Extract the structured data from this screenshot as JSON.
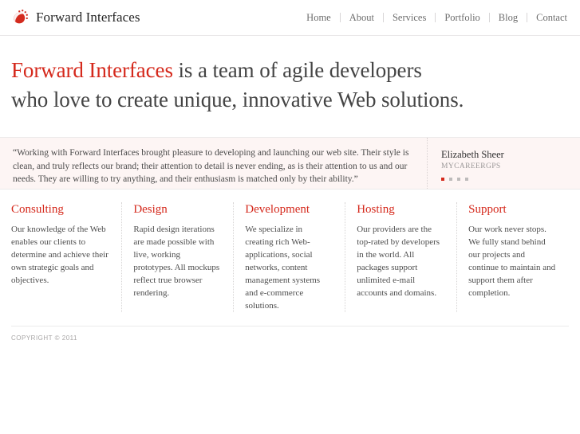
{
  "header": {
    "brand": {
      "logo_icon": "droplet-dots-logo-icon",
      "name": "Forward Interfaces"
    },
    "nav": [
      {
        "label": "Home"
      },
      {
        "label": "About"
      },
      {
        "label": "Services"
      },
      {
        "label": "Portfolio"
      },
      {
        "label": "Blog"
      },
      {
        "label": "Contact"
      }
    ]
  },
  "hero": {
    "accent": "Forward Interfaces",
    "line1_rest": " is a team of agile developers",
    "line2": "who love to create unique, innovative Web solutions."
  },
  "testimonial": {
    "quote": "“Working with Forward Interfaces brought pleasure to developing and launching our web site. Their style is clean, and truly reflects our brand; their attention to detail is never ending, as is their attention to us and our needs. They are willing to try anything, and their enthusiasm is matched only by their ability.”",
    "author_name": "Elizabeth Sheer",
    "author_company": "MYCAREERGPS",
    "dots": [
      {
        "active": true
      },
      {
        "active": false
      },
      {
        "active": false
      },
      {
        "active": false
      }
    ]
  },
  "services": [
    {
      "title": "Consulting",
      "body": "Our knowledge of the Web enables our clients to determine and achieve their own strategic goals and objectives."
    },
    {
      "title": "Design",
      "body": "Rapid design iterations are made possible with live, working prototypes. All mockups reflect true browser rendering."
    },
    {
      "title": "Development",
      "body": "We specialize in creating rich Web-applications, social networks, content management systems and e-commerce solutions."
    },
    {
      "title": "Hosting",
      "body": "Our providers are the top-rated by developers in the world. All packages support unlimited e-mail accounts and domains."
    },
    {
      "title": "Support",
      "body": "Our work never stops. We fully stand behind our projects and continue to maintain and support them after completion."
    }
  ],
  "footer": {
    "copyright": "COPYRIGHT © 2011"
  },
  "colors": {
    "accent_red": "#d5291c",
    "text": "#444444",
    "muted": "#9b9898",
    "testimonial_bg": "#fdf5f4"
  }
}
